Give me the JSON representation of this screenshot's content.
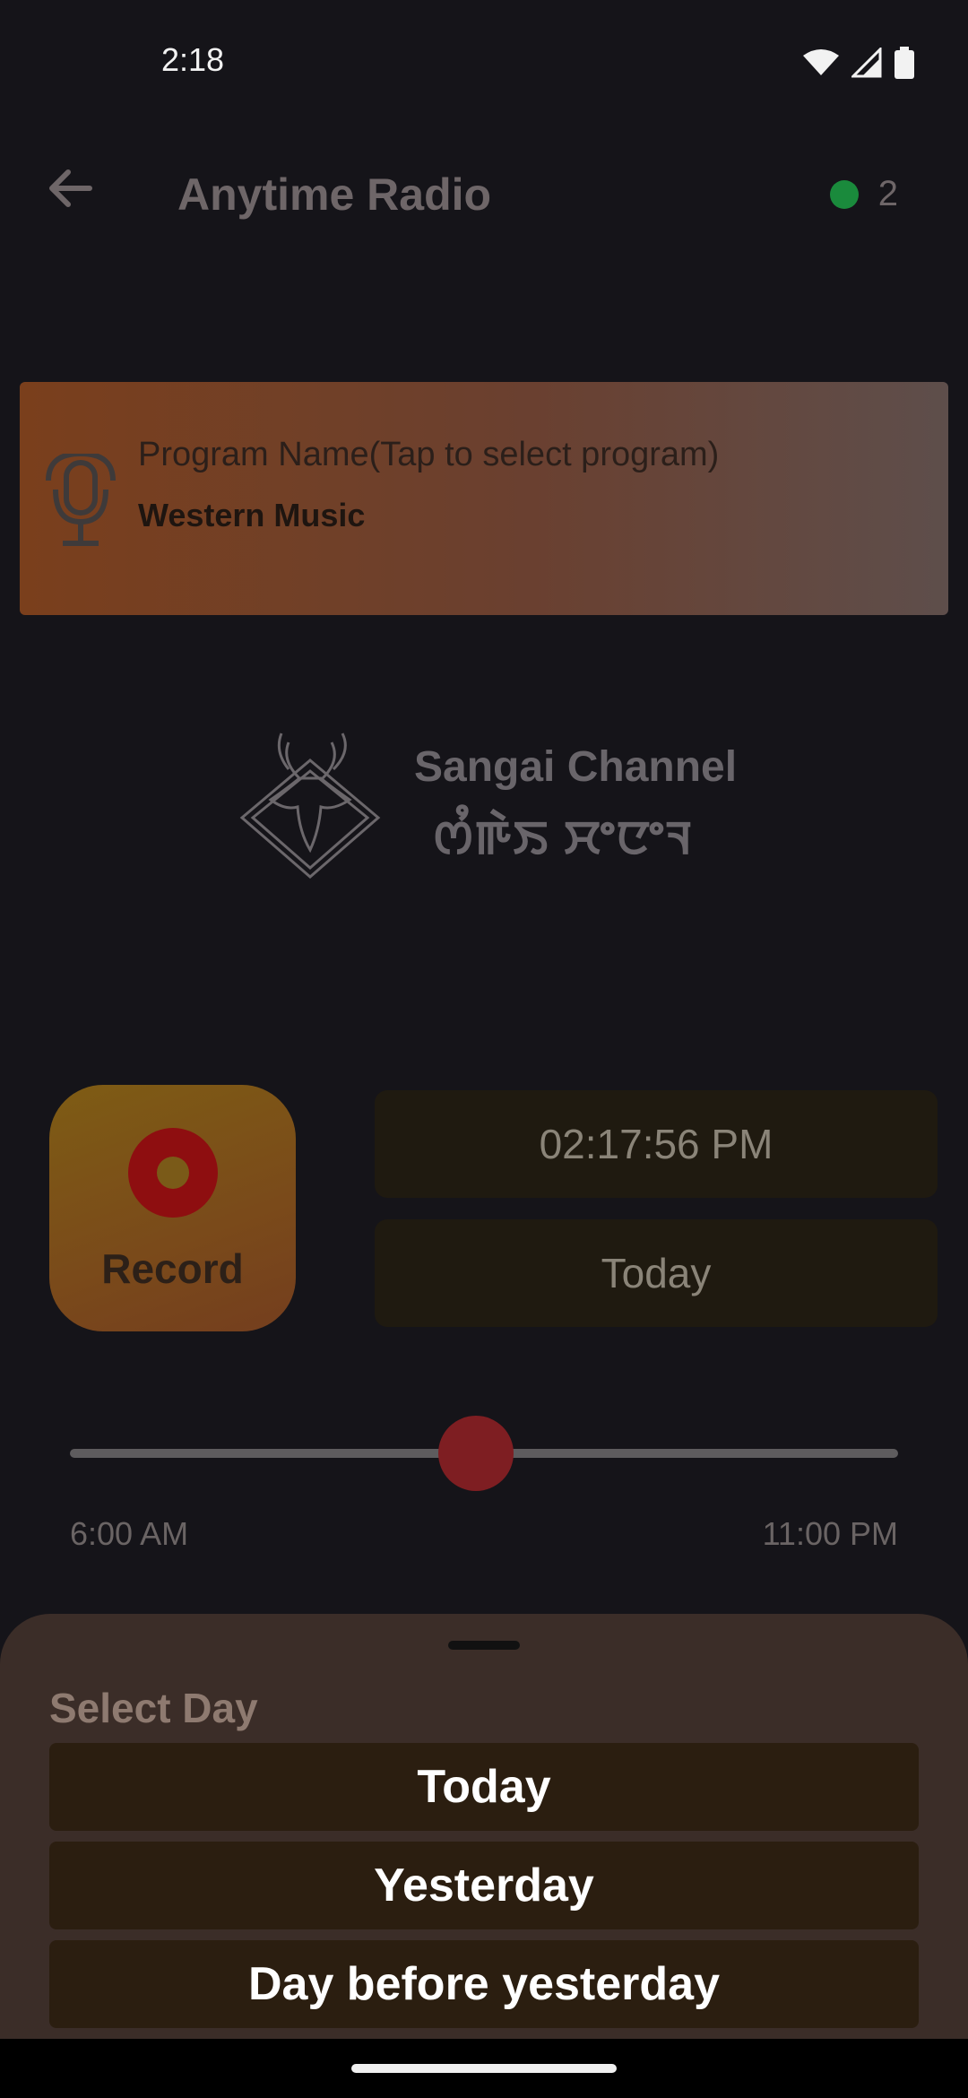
{
  "status_bar": {
    "time": "2:18",
    "icons": [
      "wifi-icon",
      "signal-icon",
      "battery-icon"
    ]
  },
  "app_bar": {
    "title": "Anytime Radio",
    "connection_count": "2",
    "connection_color": "#1a8a3c"
  },
  "program": {
    "label": "Program Name(Tap to select program)",
    "value": "Western Music"
  },
  "channel": {
    "name": "Sangai Channel",
    "script_name": "ꯁꯪꯒꯥꯏ ꯆꯦꯅꯦꯜ"
  },
  "record": {
    "label": "Record"
  },
  "timestamp": {
    "time": "02:17:56 PM",
    "day": "Today"
  },
  "slider": {
    "start_label": "6:00 AM",
    "end_label": "11:00 PM",
    "position_fraction": 0.49
  },
  "day_sheet": {
    "title": "Select Day",
    "options": [
      "Today",
      "Yesterday",
      "Day before yesterday"
    ]
  },
  "colors": {
    "accent_red": "#8e0e10",
    "sheet_bg": "#3b2d28",
    "option_bg": "#2b1e10"
  }
}
